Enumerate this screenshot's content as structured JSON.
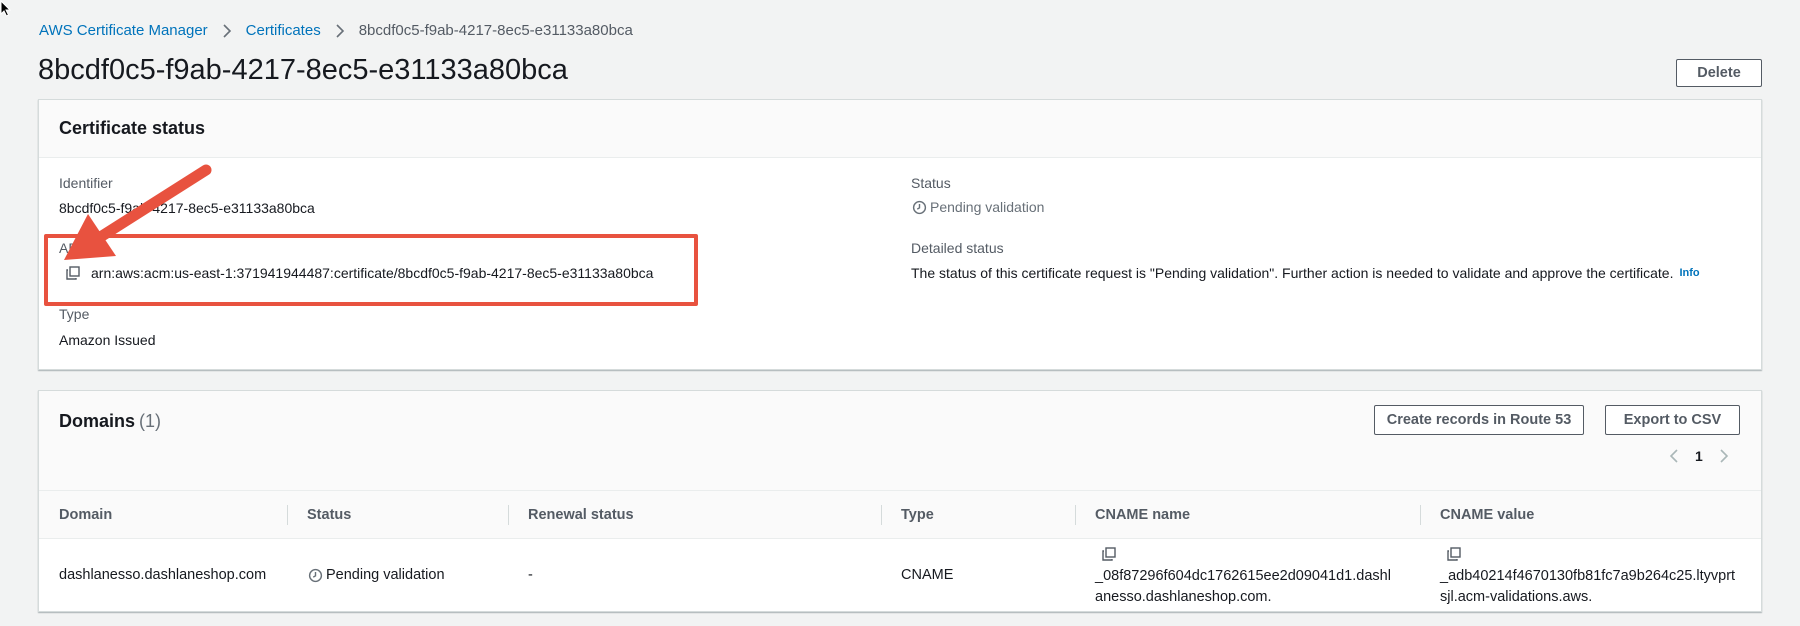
{
  "breadcrumb": {
    "items": [
      "AWS Certificate Manager",
      "Certificates"
    ],
    "current": "8bcdf0c5-f9ab-4217-8ec5-e31133a80bca"
  },
  "page": {
    "title": "8bcdf0c5-f9ab-4217-8ec5-e31133a80bca",
    "delete_label": "Delete"
  },
  "certificate_status": {
    "heading": "Certificate status",
    "identifier_label": "Identifier",
    "identifier_value": "8bcdf0c5-f9ab-4217-8ec5-e31133a80bca",
    "arn_label": "ARN",
    "arn_value": "arn:aws:acm:us-east-1:371941944487:certificate/8bcdf0c5-f9ab-4217-8ec5-e31133a80bca",
    "type_label": "Type",
    "type_value": "Amazon Issued",
    "status_label": "Status",
    "status_value": "Pending validation",
    "detailed_label": "Detailed status",
    "detailed_value": "The status of this certificate request is \"Pending validation\". Further action is needed to validate and approve the certificate.",
    "info_label": "Info"
  },
  "domains": {
    "heading": "Domains",
    "count": "(1)",
    "create_records_label": "Create records in Route 53",
    "export_label": "Export to CSV",
    "page_number": "1",
    "columns": [
      "Domain",
      "Status",
      "Renewal status",
      "Type",
      "CNAME name",
      "CNAME value"
    ],
    "rows": [
      {
        "domain": "dashlanesso.dashlaneshop.com",
        "status": "Pending validation",
        "renewal_status": "-",
        "type": "CNAME",
        "cname_name": "_08f87296f604dc1762615ee2d09041d1.dashlanesso.dashlaneshop.com.",
        "cname_value": "_adb40214f4670130fb81fc7a9b264c25.ltyvprtsjl.acm-validations.aws."
      }
    ]
  },
  "colors": {
    "link": "#0073bb",
    "annotation": "#e8523f",
    "text": "#16191f",
    "muted": "#687078"
  }
}
